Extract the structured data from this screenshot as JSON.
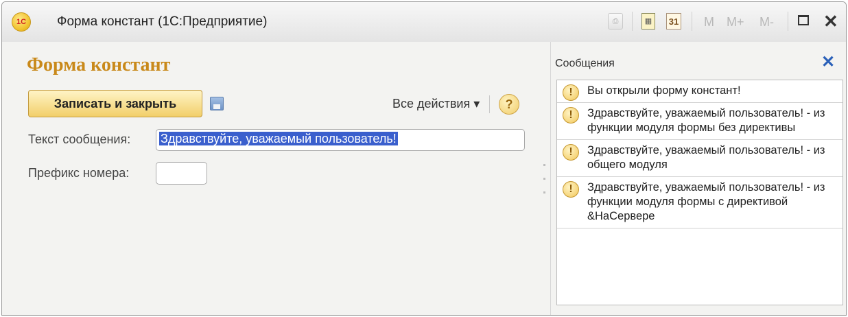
{
  "window": {
    "title": "Форма констант  (1С:Предприятие)",
    "logo_text": "1С",
    "toolbar": {
      "print_icon": "print-icon",
      "calc_icon": "calculator-icon",
      "calendar_icon_text": "31",
      "mem_buttons": [
        "M",
        "M+",
        "M-"
      ],
      "maximize_icon": "maximize-icon",
      "close_glyph": "✕"
    }
  },
  "form": {
    "title": "Форма констант",
    "save_close_label": "Записать и закрыть",
    "all_actions_label": "Все действия ▾",
    "help_glyph": "?",
    "fields": {
      "message_text_label": "Текст сообщения:",
      "message_text_value": "Здравствуйте, уважаемый пользователь!",
      "number_prefix_label": "Префикс номера:",
      "number_prefix_value": ""
    }
  },
  "messages": {
    "header": "Сообщения",
    "close_glyph": "✕",
    "items": [
      "Вы открыли форму констант!",
      "Здравствуйте, уважаемый пользователь! - из функции модуля формы без директивы",
      "Здравствуйте, уважаемый пользователь! - из общего модуля",
      "Здравствуйте, уважаемый пользователь! - из функции модуля формы с директивой &НаСервере"
    ],
    "icon_glyph": "!"
  },
  "colors": {
    "form_title": "#c9891a",
    "primary_button": "#f2cf6a",
    "selection": "#3a5fcd",
    "close_link": "#2a60b8"
  }
}
